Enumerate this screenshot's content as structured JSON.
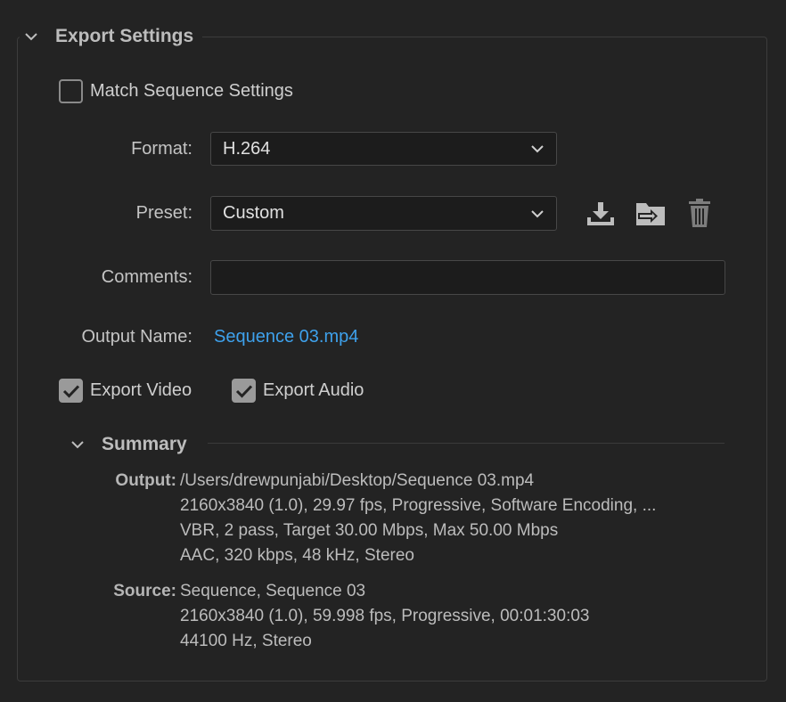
{
  "export_settings": {
    "title": "Export Settings",
    "match_sequence": {
      "label": "Match Sequence Settings",
      "checked": false
    },
    "format": {
      "label": "Format:",
      "value": "H.264"
    },
    "preset": {
      "label": "Preset:",
      "value": "Custom"
    },
    "comments": {
      "label": "Comments:",
      "value": ""
    },
    "output_name": {
      "label": "Output Name:",
      "value": "Sequence 03.mp4"
    },
    "export_video": {
      "label": "Export Video",
      "checked": true
    },
    "export_audio": {
      "label": "Export Audio",
      "checked": true
    },
    "preset_icons": [
      "save-preset-icon",
      "import-preset-icon",
      "delete-preset-icon"
    ]
  },
  "summary": {
    "title": "Summary",
    "output_label": "Output:",
    "output_lines": [
      "/Users/drewpunjabi/Desktop/Sequence 03.mp4",
      "2160x3840 (1.0), 29.97 fps, Progressive, Software Encoding, ...",
      "VBR, 2 pass, Target 30.00 Mbps, Max 50.00 Mbps",
      "AAC, 320 kbps, 48 kHz, Stereo"
    ],
    "source_label": "Source:",
    "source_lines": [
      "Sequence, Sequence 03",
      "2160x3840 (1.0), 59.998 fps, Progressive, 00:01:30:03",
      "44100 Hz, Stereo"
    ]
  },
  "colors": {
    "background": "#232323",
    "link": "#3ea1ec",
    "field_bg": "#1c1c1c"
  }
}
